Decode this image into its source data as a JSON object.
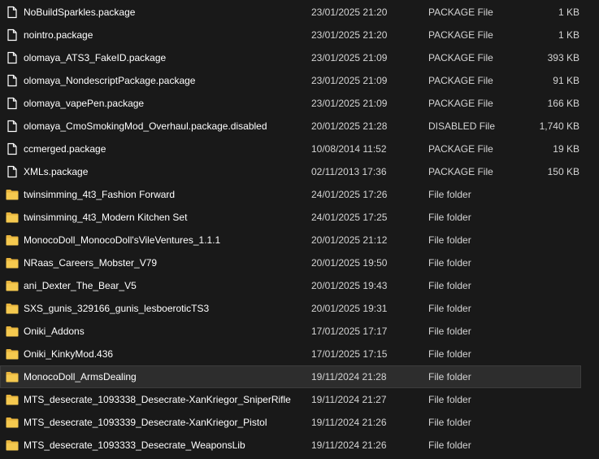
{
  "colors": {
    "background": "#191919",
    "selected_row": "#2d2d2d",
    "folder_icon": "#f0c04a",
    "file_icon": "#ffffff"
  },
  "files": [
    {
      "name": "NoBuildSparkles.package",
      "date": "23/01/2025 21:20",
      "type": "PACKAGE File",
      "size": "1 KB",
      "icon": "file-icon",
      "selected": false
    },
    {
      "name": "nointro.package",
      "date": "23/01/2025 21:20",
      "type": "PACKAGE File",
      "size": "1 KB",
      "icon": "file-icon",
      "selected": false
    },
    {
      "name": "olomaya_ATS3_FakeID.package",
      "date": "23/01/2025 21:09",
      "type": "PACKAGE File",
      "size": "393 KB",
      "icon": "file-icon",
      "selected": false
    },
    {
      "name": "olomaya_NondescriptPackage.package",
      "date": "23/01/2025 21:09",
      "type": "PACKAGE File",
      "size": "91 KB",
      "icon": "file-icon",
      "selected": false
    },
    {
      "name": "olomaya_vapePen.package",
      "date": "23/01/2025 21:09",
      "type": "PACKAGE File",
      "size": "166 KB",
      "icon": "file-icon",
      "selected": false
    },
    {
      "name": "olomaya_CmoSmokingMod_Overhaul.package.disabled",
      "date": "20/01/2025 21:28",
      "type": "DISABLED File",
      "size": "1,740 KB",
      "icon": "file-icon",
      "selected": false
    },
    {
      "name": "ccmerged.package",
      "date": "10/08/2014 11:52",
      "type": "PACKAGE File",
      "size": "19 KB",
      "icon": "file-icon",
      "selected": false
    },
    {
      "name": "XMLs.package",
      "date": "02/11/2013 17:36",
      "type": "PACKAGE File",
      "size": "150 KB",
      "icon": "file-icon",
      "selected": false
    },
    {
      "name": "twinsimming_4t3_Fashion Forward",
      "date": "24/01/2025 17:26",
      "type": "File folder",
      "size": "",
      "icon": "folder-icon",
      "selected": false
    },
    {
      "name": "twinsimming_4t3_Modern Kitchen Set",
      "date": "24/01/2025 17:25",
      "type": "File folder",
      "size": "",
      "icon": "folder-icon",
      "selected": false
    },
    {
      "name": "MonocoDoll_MonocoDoll'sVileVentures_1.1.1",
      "date": "20/01/2025 21:12",
      "type": "File folder",
      "size": "",
      "icon": "folder-icon",
      "selected": false
    },
    {
      "name": "NRaas_Careers_Mobster_V79",
      "date": "20/01/2025 19:50",
      "type": "File folder",
      "size": "",
      "icon": "folder-icon",
      "selected": false
    },
    {
      "name": "ani_Dexter_The_Bear_V5",
      "date": "20/01/2025 19:43",
      "type": "File folder",
      "size": "",
      "icon": "folder-icon",
      "selected": false
    },
    {
      "name": "SXS_gunis_329166_gunis_lesboeroticTS3",
      "date": "20/01/2025 19:31",
      "type": "File folder",
      "size": "",
      "icon": "folder-icon",
      "selected": false
    },
    {
      "name": "Oniki_Addons",
      "date": "17/01/2025 17:17",
      "type": "File folder",
      "size": "",
      "icon": "folder-icon",
      "selected": false
    },
    {
      "name": "Oniki_KinkyMod.436",
      "date": "17/01/2025 17:15",
      "type": "File folder",
      "size": "",
      "icon": "folder-icon",
      "selected": false
    },
    {
      "name": "MonocoDoll_ArmsDealing",
      "date": "19/11/2024 21:28",
      "type": "File folder",
      "size": "",
      "icon": "folder-icon",
      "selected": true
    },
    {
      "name": "MTS_desecrate_1093338_Desecrate-XanKriegor_SniperRifle",
      "date": "19/11/2024 21:27",
      "type": "File folder",
      "size": "",
      "icon": "folder-icon",
      "selected": false
    },
    {
      "name": "MTS_desecrate_1093339_Desecrate-XanKriegor_Pistol",
      "date": "19/11/2024 21:26",
      "type": "File folder",
      "size": "",
      "icon": "folder-icon",
      "selected": false
    },
    {
      "name": "MTS_desecrate_1093333_Desecrate_WeaponsLib",
      "date": "19/11/2024 21:26",
      "type": "File folder",
      "size": "",
      "icon": "folder-icon",
      "selected": false
    }
  ]
}
